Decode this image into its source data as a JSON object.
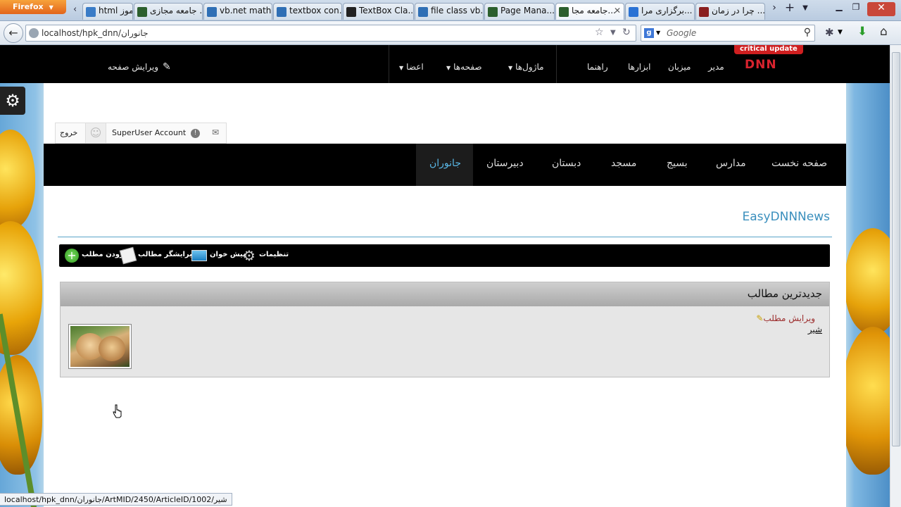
{
  "browser": {
    "app_button": "Firefox",
    "tabs": [
      {
        "label": "html آموز...",
        "icon_color": "#3a7cc7"
      },
      {
        "label": "جامعه مجازی ...",
        "icon_color": "#2c5f2d"
      },
      {
        "label": "vb.net math...",
        "icon_color": "#2f6fb5"
      },
      {
        "label": "textbox con...",
        "icon_color": "#2f6fb5"
      },
      {
        "label": "TextBox Cla...",
        "icon_color": "#222222"
      },
      {
        "label": "file class vb...",
        "icon_color": "#2f6fb5"
      },
      {
        "label": "Page Mana...",
        "icon_color": "#2c5f2d"
      },
      {
        "label": "جامعه مجا...",
        "icon_color": "#2c5f2d",
        "active": true
      },
      {
        "label": "برگزاری مرا...",
        "icon_color": "#2a72d4"
      },
      {
        "label": "چرا در زمان ...",
        "icon_color": "#8a1f1f"
      }
    ],
    "url": "localhost/hpk_dnn/جانوران",
    "search_engine_icon": "google-icon",
    "search_placeholder": "Google"
  },
  "controlbar": {
    "logo": "DNN",
    "critical_update": "critical update",
    "items": [
      "مدیر",
      "میزبان",
      "ابزارها",
      "راهنما"
    ],
    "dropdowns": [
      "ماژول‌ها",
      "صفحه‌ها",
      "اعضا"
    ],
    "edit_page": "ویرایش صفحه"
  },
  "userbar": {
    "logout": "خروج",
    "user_name": "SuperUser Account"
  },
  "menu": {
    "items": [
      "صفحه نخست",
      "مدارس",
      "بسیج",
      "مسجد",
      "دبستان",
      "دبیرستان",
      "جانوران"
    ],
    "active": "جانوران"
  },
  "module": {
    "title": "EasyDNNNews",
    "toolbar": {
      "add_article": "افزودن مطلب",
      "article_editor": "ویرایشگر مطالب",
      "preview": "پیش خوان",
      "settings": "تنظیمات"
    },
    "panel_title": "جدیدترین مطالب",
    "edit_article": "ویرایش مطلب",
    "article_title": "شیر"
  },
  "statusbar": {
    "text": "localhost/hpk_dnn/جانوران/ArtMID/2450/ArticleID/1002/شیر"
  },
  "colors": {
    "controlbar_bg": "#000000",
    "critical": "#cf1f20",
    "module_title": "#3a8fbd",
    "edit_link": "#9c2c2c"
  }
}
